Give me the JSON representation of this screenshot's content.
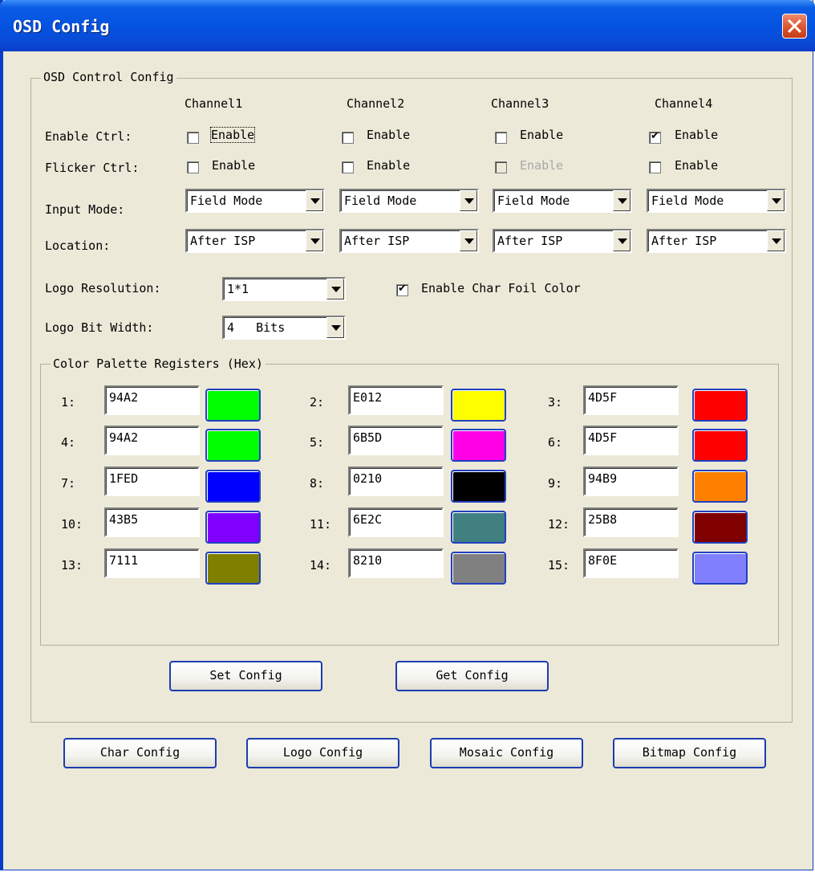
{
  "window": {
    "title": "OSD Config"
  },
  "osd_group": {
    "label": "OSD Control Config"
  },
  "channels": [
    "Channel1",
    "Channel2",
    "Channel3",
    "Channel4"
  ],
  "rows": {
    "enable_ctrl": "Enable Ctrl:",
    "flicker_ctrl": "Flicker Ctrl:",
    "input_mode": "Input Mode:",
    "location": "Location:"
  },
  "enable_ctrl": [
    {
      "label": "Enable",
      "checked": false,
      "disabled": false
    },
    {
      "label": "Enable",
      "checked": false,
      "disabled": false
    },
    {
      "label": "Enable",
      "checked": false,
      "disabled": false
    },
    {
      "label": "Enable",
      "checked": true,
      "disabled": false
    }
  ],
  "flicker_ctrl": [
    {
      "label": "Enable",
      "checked": false,
      "disabled": false
    },
    {
      "label": "Enable",
      "checked": false,
      "disabled": false
    },
    {
      "label": "Enable",
      "checked": false,
      "disabled": true
    },
    {
      "label": "Enable",
      "checked": false,
      "disabled": false
    }
  ],
  "input_mode": [
    "Field Mode",
    "Field Mode",
    "Field Mode",
    "Field Mode"
  ],
  "location": [
    "After ISP",
    "After ISP",
    "After ISP",
    "After ISP"
  ],
  "logo_resolution": {
    "label": "Logo Resolution:",
    "value": "1*1"
  },
  "char_foil": {
    "label": "Enable Char Foil Color",
    "checked": true
  },
  "logo_bit_width": {
    "label": "Logo Bit Width:",
    "value": "4   Bits"
  },
  "palette": {
    "label": "Color Palette Registers (Hex)",
    "entries": [
      {
        "num": "1:",
        "hex": "94A2",
        "color": "#00ff00"
      },
      {
        "num": "2:",
        "hex": "E012",
        "color": "#ffff00"
      },
      {
        "num": "3:",
        "hex": "4D5F",
        "color": "#ff0000"
      },
      {
        "num": "4:",
        "hex": "94A2",
        "color": "#00ff00"
      },
      {
        "num": "5:",
        "hex": "6B5D",
        "color": "#ff00e6"
      },
      {
        "num": "6:",
        "hex": "4D5F",
        "color": "#ff0000"
      },
      {
        "num": "7:",
        "hex": "1FED",
        "color": "#0000ff"
      },
      {
        "num": "8:",
        "hex": "0210",
        "color": "#000000"
      },
      {
        "num": "9:",
        "hex": "94B9",
        "color": "#ff8000"
      },
      {
        "num": "10:",
        "hex": "43B5",
        "color": "#8000ff"
      },
      {
        "num": "11:",
        "hex": "6E2C",
        "color": "#408080"
      },
      {
        "num": "12:",
        "hex": "25B8",
        "color": "#800000"
      },
      {
        "num": "13:",
        "hex": "7111",
        "color": "#808000"
      },
      {
        "num": "14:",
        "hex": "8210",
        "color": "#808080"
      },
      {
        "num": "15:",
        "hex": "8F0E",
        "color": "#8080ff"
      }
    ]
  },
  "buttons": {
    "set_config": "Set Config",
    "get_config": "Get Config",
    "char_config": "Char Config",
    "logo_config": "Logo Config",
    "mosaic_config": "Mosaic Config",
    "bitmap_config": "Bitmap Config"
  }
}
